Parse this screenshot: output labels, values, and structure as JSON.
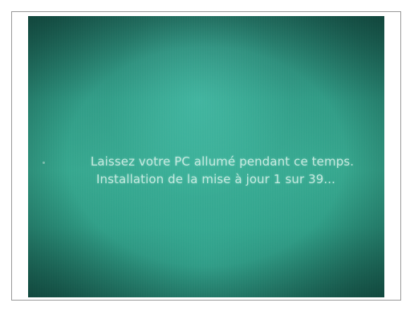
{
  "screen": {
    "line1": "Laissez votre PC allumé pendant ce temps.",
    "line2": "Installation de la mise à jour 1 sur 39..."
  },
  "colors": {
    "screen_background": "#2f9a84",
    "text": "#e1f5ee",
    "frame": "#ffffff"
  }
}
